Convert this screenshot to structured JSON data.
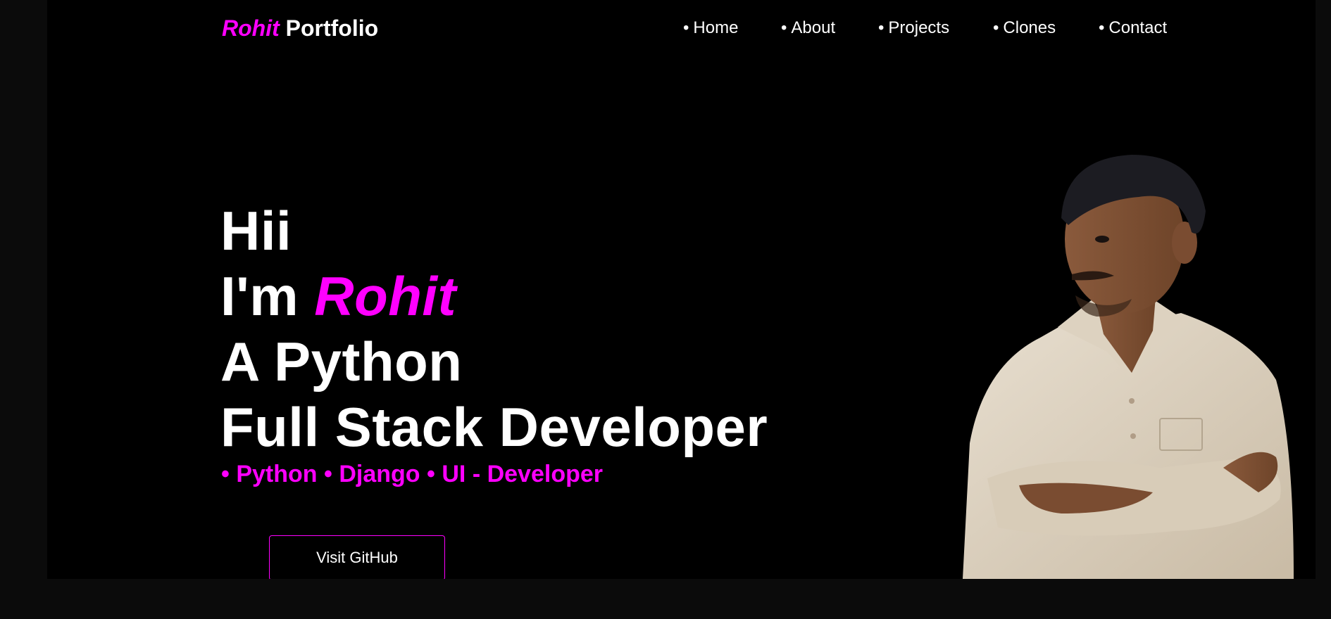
{
  "brand": {
    "first": "Rohit",
    "second": "Portfolio"
  },
  "nav": {
    "bullet": "•",
    "items": [
      {
        "label": "Home"
      },
      {
        "label": "About"
      },
      {
        "label": "Projects"
      },
      {
        "label": "Clones"
      },
      {
        "label": "Contact"
      }
    ]
  },
  "hero": {
    "greeting": "Hii",
    "im": "I'm",
    "name": "Rohit",
    "role_line1": "A Python",
    "role_line2": "Full Stack Developer",
    "skills": "• Python • Django • UI - Developer",
    "cta_label": "Visit GitHub"
  },
  "colors": {
    "accent": "#ff00ff",
    "background": "#000000",
    "outer_background": "#0b0b0b",
    "text": "#ffffff"
  },
  "icons": {
    "portrait": "profile-photo-man-crossed-arms"
  }
}
